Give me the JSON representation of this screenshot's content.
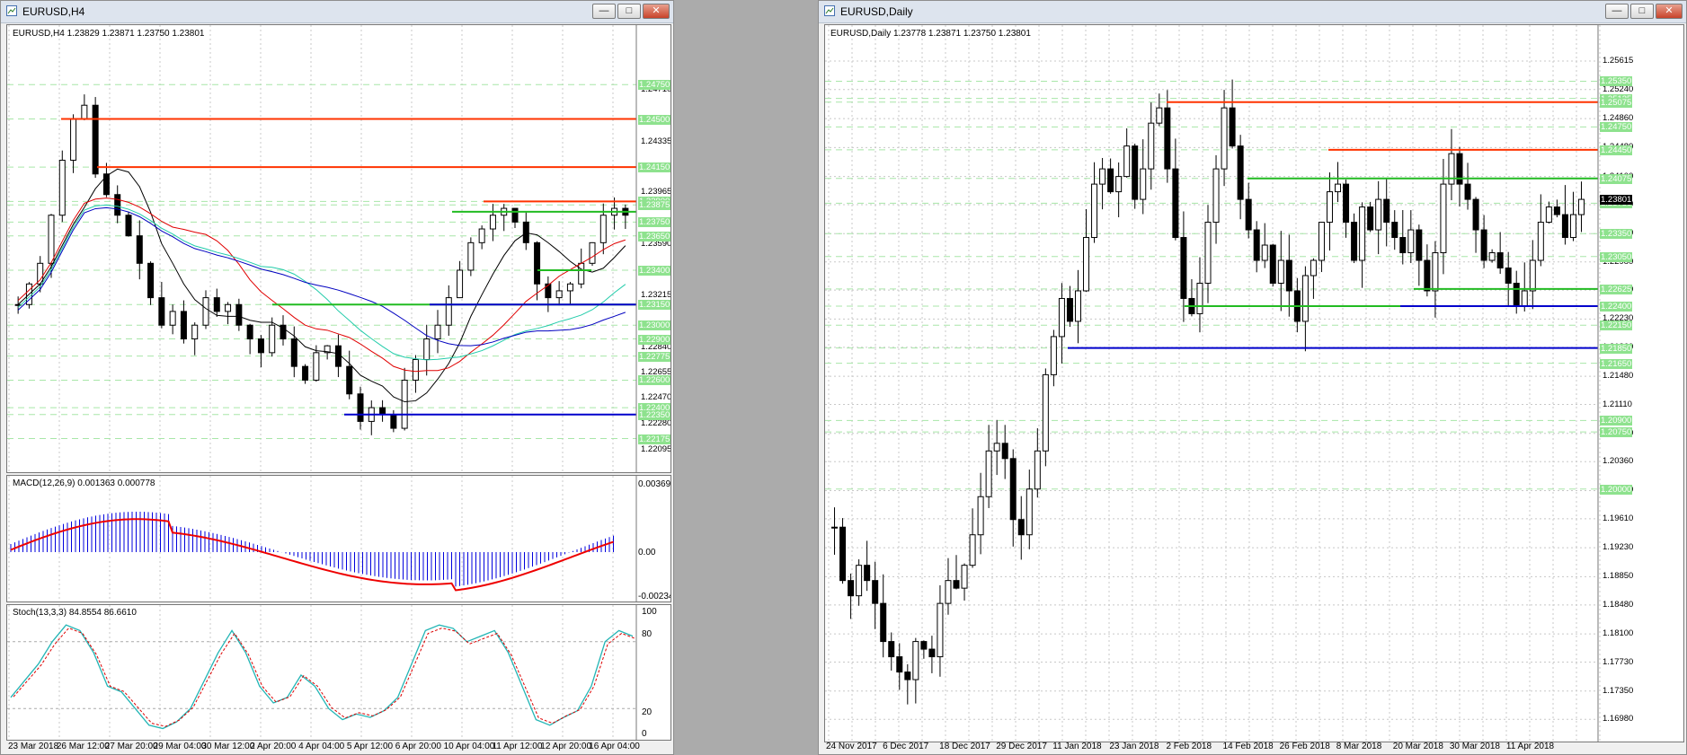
{
  "left": {
    "title": "EURUSD,H4",
    "header": "EURUSD,H4  1.23829 1.23871 1.23750 1.23801",
    "price_ticks": [
      "1.24710",
      "1.24335",
      "1.23965",
      "1.23590",
      "1.23215",
      "1.22840",
      "1.22655",
      "1.22470",
      "1.22280",
      "1.22095"
    ],
    "level_tags": [
      "1.24750",
      "1.24500",
      "1.24150",
      "1.23900",
      "1.23875",
      "1.23750",
      "1.23650",
      "1.23400",
      "1.23150",
      "1.23000",
      "1.22900",
      "1.22775",
      "1.22600",
      "1.22400",
      "1.22350",
      "1.22175"
    ],
    "macd_header": "MACD(12,26,9) 0.001363 0.000778",
    "macd_ticks": [
      "0.003693",
      "0.00",
      "-0.002347"
    ],
    "stoch_header": "Stoch(13,3,3) 84.8554 86.6610",
    "stoch_ticks": [
      "100",
      "80",
      "20",
      "0"
    ],
    "time_labels": [
      "23 Mar 2018",
      "26 Mar 12:00",
      "27 Mar 20:00",
      "29 Mar 04:00",
      "30 Mar 12:00",
      "2 Apr 20:00",
      "4 Apr 04:00",
      "5 Apr 12:00",
      "6 Apr 20:00",
      "10 Apr 04:00",
      "11 Apr 12:00",
      "12 Apr 20:00",
      "16 Apr 04:00"
    ]
  },
  "right": {
    "title": "EURUSD,Daily",
    "header": "EURUSD,Daily  1.23778 1.23871 1.23750 1.23801",
    "price_ticks": [
      "1.25615",
      "1.25240",
      "1.24860",
      "1.24480",
      "1.24100",
      "1.23730",
      "1.23350",
      "1.22980",
      "1.22610",
      "1.22230",
      "1.21860",
      "1.21480",
      "1.21110",
      "1.20730",
      "1.20360",
      "1.19980",
      "1.19610",
      "1.19230",
      "1.18850",
      "1.18480",
      "1.18100",
      "1.17730",
      "1.17350",
      "1.16980"
    ],
    "level_tags": [
      "1.25350",
      "1.25125",
      "1.25075",
      "1.24750",
      "1.24450",
      "1.24075",
      "1.23750",
      "1.23350",
      "1.23050",
      "1.22625",
      "1.22400",
      "1.22150",
      "1.21850",
      "1.21650",
      "1.20900",
      "1.20750",
      "1.20000"
    ],
    "current_price": "1.23801",
    "time_labels": [
      "24 Nov 2017",
      "6 Dec 2017",
      "18 Dec 2017",
      "29 Dec 2017",
      "11 Jan 2018",
      "23 Jan 2018",
      "2 Feb 2018",
      "14 Feb 2018",
      "26 Feb 2018",
      "8 Mar 2018",
      "20 Mar 2018",
      "30 Mar 2018",
      "11 Apr 2018"
    ]
  },
  "colors": {
    "red_level": "#FF3300",
    "green_level": "#22BB22",
    "blue_level": "#0000CC",
    "macd_hist": "#0000DD",
    "signal": "#EE0000",
    "stoch_main": "#22B5B5",
    "stoch_signal": "#DD0000",
    "grid": "#C8C8C8",
    "tag_green": "#8EE28E"
  }
}
